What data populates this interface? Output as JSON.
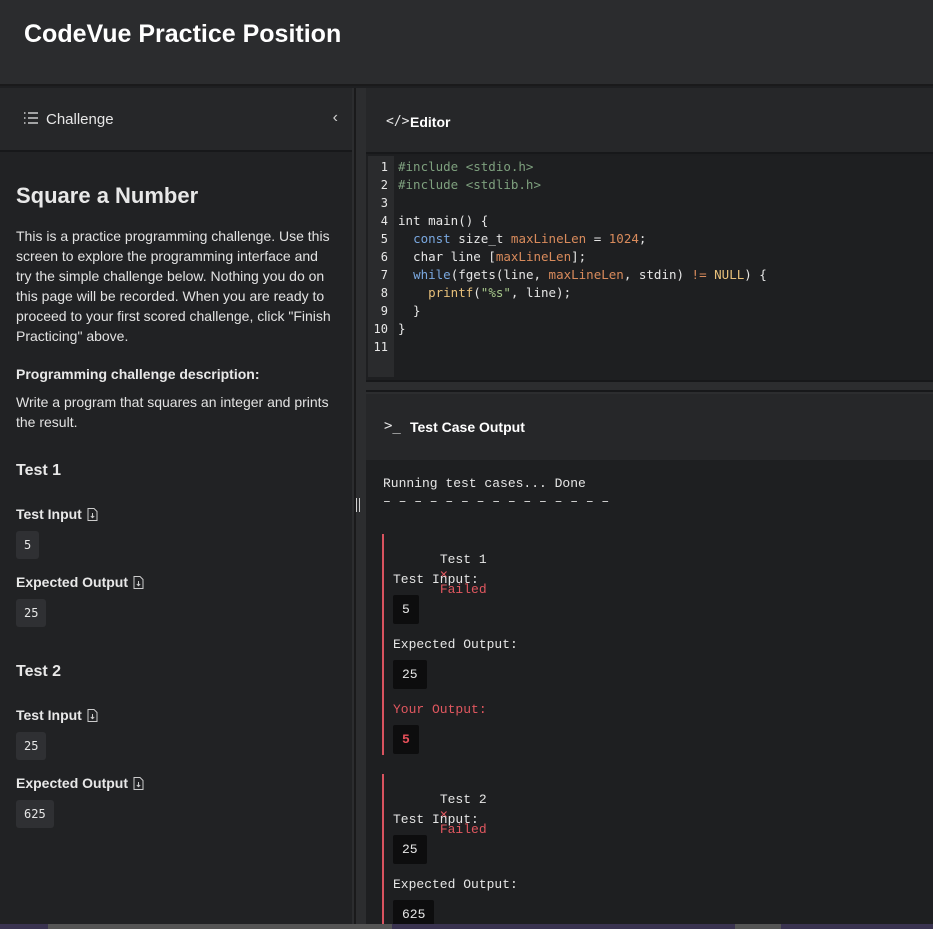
{
  "app": {
    "title": "CodeVue Practice Position"
  },
  "challenge_panel": {
    "header_label": "Challenge",
    "collapse_icon": "chevron-left-icon",
    "title": "Square a Number",
    "intro": "This is a practice programming challenge. Use this screen to explore the programming interface and try the simple challenge below. Nothing you do on this page will be recorded. When you are ready to proceed to your first scored challenge, click \"Finish Practicing\" above.",
    "description_heading": "Programming challenge description:",
    "description": "Write a program that squares an integer and prints the result.",
    "tests": [
      {
        "title": "Test 1",
        "input_label": "Test Input",
        "input": "5",
        "output_label": "Expected Output",
        "output": "25"
      },
      {
        "title": "Test 2",
        "input_label": "Test Input",
        "input": "25",
        "output_label": "Expected Output",
        "output": "625"
      }
    ]
  },
  "editor": {
    "header_label": "Editor",
    "icon": "code-icon",
    "line_numbers": [
      "1",
      "2",
      "3",
      "4",
      "5",
      "6",
      "7",
      "8",
      "9",
      "10",
      "11"
    ],
    "lines": [
      "#include <stdio.h>",
      "#include <stdlib.h>",
      "",
      "int main() {",
      "  const size_t maxLineLen = 1024;",
      "  char line [maxLineLen];",
      "  while(fgets(line, maxLineLen, stdin) != NULL) {",
      "    printf(\"%s\", line);",
      "  }",
      "}",
      ""
    ]
  },
  "output": {
    "header_label": "Test Case Output",
    "icon": "terminal-icon",
    "status_line": "Running test cases... Done",
    "separator": "– – – – – – – – – – – – – – –",
    "results": [
      {
        "label": "Test 1",
        "status_icon": "x-icon",
        "status": "Failed",
        "input_label": "Test Input:",
        "input": "5",
        "expected_label": "Expected Output:",
        "expected": "25",
        "your_label": "Your Output:",
        "your": "5"
      },
      {
        "label": "Test 2",
        "status_icon": "x-icon",
        "status": "Failed",
        "input_label": "Test Input:",
        "input": "25",
        "expected_label": "Expected Output:",
        "expected": "625"
      }
    ]
  },
  "colors": {
    "fail": "#e0575f",
    "accent_border": "#d9535f",
    "background": "#1e1f21"
  }
}
